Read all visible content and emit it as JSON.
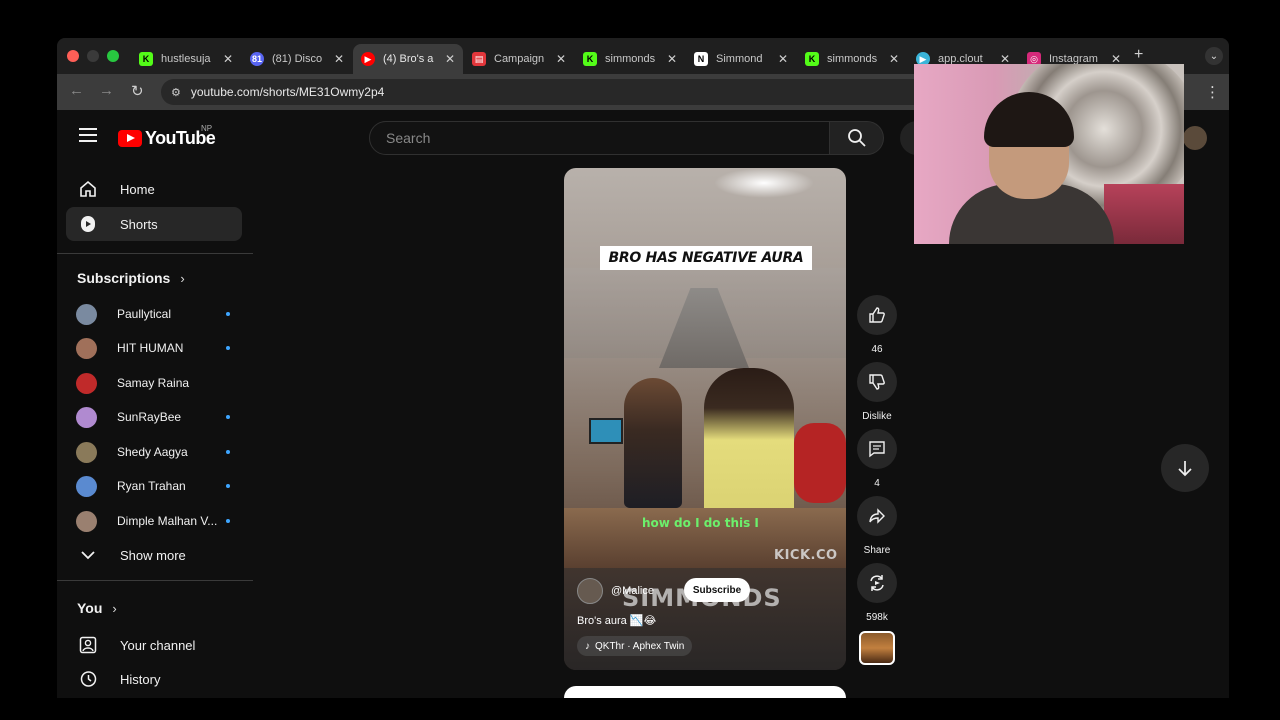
{
  "browser": {
    "tabs": [
      {
        "title": "hustlesuja",
        "favicon": "K",
        "favicon_color": "#53fc18",
        "active": false
      },
      {
        "title": "(81) Disco",
        "favicon": "81",
        "favicon_color": "#5865f2",
        "active": false
      },
      {
        "title": "(4) Bro's a",
        "favicon": "yt",
        "favicon_color": "#ff0000",
        "active": true
      },
      {
        "title": "Campaign",
        "favicon": "C",
        "favicon_color": "#e2363b",
        "active": false
      },
      {
        "title": "simmonds",
        "favicon": "K",
        "favicon_color": "#53fc18",
        "active": false
      },
      {
        "title": "Simmond",
        "favicon": "N",
        "favicon_color": "#888888",
        "active": false
      },
      {
        "title": "simmonds",
        "favicon": "K",
        "favicon_color": "#53fc18",
        "active": false
      },
      {
        "title": "app.clout",
        "favicon": "a",
        "favicon_color": "#3ab4d8",
        "active": false
      },
      {
        "title": "Instagram",
        "favicon": "ig",
        "favicon_color": "#d6297a",
        "active": false
      }
    ],
    "url": "youtube.com/shorts/ME31Owmy2p4"
  },
  "youtube": {
    "logo_text": "YouTube",
    "region": "NP",
    "search_placeholder": "Search"
  },
  "sidebar": {
    "main": [
      {
        "label": "Home",
        "icon": "home-icon",
        "active": false
      },
      {
        "label": "Shorts",
        "icon": "shorts-icon",
        "active": true
      }
    ],
    "subscriptions_title": "Subscriptions",
    "subscriptions": [
      {
        "name": "Paullytical",
        "dot": true,
        "color": "#7a8aa0"
      },
      {
        "name": "HIT HUMAN",
        "dot": true,
        "color": "#a0705a"
      },
      {
        "name": "Samay Raina",
        "dot": false,
        "color": "#c02a2a"
      },
      {
        "name": "SunRayBee",
        "dot": true,
        "color": "#b08ad0"
      },
      {
        "name": "Shedy Aagya",
        "dot": true,
        "color": "#8a7a5a"
      },
      {
        "name": "Ryan Trahan",
        "dot": true,
        "color": "#5a8ad0"
      },
      {
        "name": "Dimple Malhan V...",
        "dot": true,
        "color": "#9a8070"
      }
    ],
    "show_more": "Show more",
    "you_title": "You",
    "you_items": [
      {
        "label": "Your channel",
        "icon": "channel-icon"
      },
      {
        "label": "History",
        "icon": "history-icon"
      }
    ]
  },
  "short": {
    "overlay_caption": "BRO HAS NEGATIVE AURA",
    "subtitle": "how do I do this I",
    "watermark_kick": "KICK.CO",
    "creator": "@Malice",
    "subscribe_label": "Subscribe",
    "watermark_simmonds": "SIMMONDS",
    "title": "Bro's aura 📉😂",
    "music": "QKThr · Aphex Twin"
  },
  "actions": {
    "likes": "46",
    "dislike_label": "Dislike",
    "comments": "4",
    "share_label": "Share",
    "remix_count": "598k"
  }
}
